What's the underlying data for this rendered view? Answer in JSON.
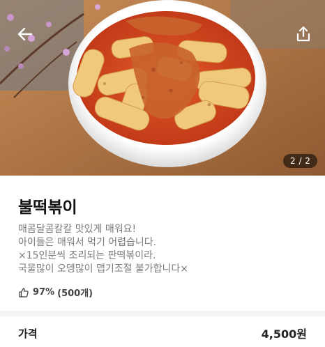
{
  "header": {
    "back_icon": "arrow-left-icon",
    "share_icon": "share-icon",
    "image_counter": "2 / 2"
  },
  "menu": {
    "name": "불떡볶이",
    "description": [
      "매콤달콤칼칼 맛있게 매워요!",
      "아이들은 매워서 먹기 어렵습니다.",
      "×15인분씩 조리되는 판떡볶이라.",
      "국물많이 오뎅많이 맵기조절 불가합니다×"
    ],
    "rating_icon": "thumbs-up-icon",
    "rating_percent": "97%",
    "rating_count": "(500개)"
  },
  "price": {
    "label": "가격",
    "value": "4,500원"
  },
  "colors": {
    "sauce": "#d9411f",
    "rice_cake": "#f0c878",
    "board": "#b07a4a",
    "counter_bg": "#5a5a5a"
  }
}
